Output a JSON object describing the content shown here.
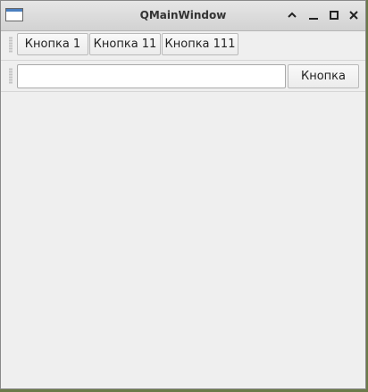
{
  "window": {
    "title": "QMainWindow",
    "icon": "app-window-icon",
    "controls": [
      "shade-icon",
      "minimize-icon",
      "maximize-icon",
      "close-icon"
    ]
  },
  "toolbar1": {
    "buttons": [
      "Кнопка 1",
      "Кнопка 11",
      "Кнопка 111"
    ]
  },
  "toolbar2": {
    "input_value": "",
    "button_label": "Кнопка"
  },
  "colors": {
    "window_bg": "#efefef",
    "titlebar_bg": "#d9d9d9"
  }
}
